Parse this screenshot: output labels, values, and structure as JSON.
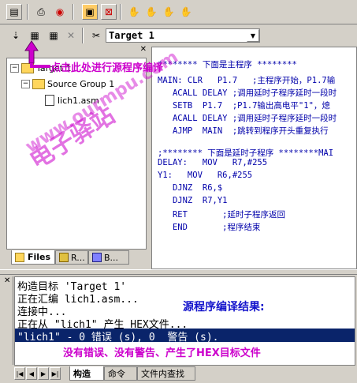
{
  "toolbar2": {
    "target_select": "Target 1"
  },
  "project_tree": {
    "root": "Target 1",
    "group": "Source Group 1",
    "file": "lich1.asm"
  },
  "project_tabs": {
    "files": "Files",
    "regs_label": "R...",
    "books_label": "B..."
  },
  "editor": {
    "lines": [
      "******** 下面是主程序 ********",
      "MAIN: CLR   P1.7   ;主程序开始，P1.7输",
      "   ACALL DELAY ;调用延时子程序延时一段时",
      "   SETB  P1.7  ;P1.7输出高电平\"1\"，熄",
      "   ACALL DELAY ;调用延时子程序延时一段时",
      "   AJMP  MAIN  ;跳转到程序开头重复执行",
      "",
      ";******** 下面是延时子程序 ********MAI",
      "DELAY:   MOV   R7,#255",
      "Y1:   MOV   R6,#255",
      "   DJNZ  R6,$",
      "   DJNZ  R7,Y1",
      "   RET       ;延时子程序返回",
      "   END       ;程序结束"
    ]
  },
  "annotations": {
    "compile_hint": "点击此处进行源程序编译",
    "watermark_1": "电子驿站",
    "watermark_2": "www.ourmpu.com",
    "result_title": "源程序编译结果:",
    "result_desc": "没有错误、没有警告、产生了HEX目标文件"
  },
  "output": {
    "lines": [
      "构造目标 'Target 1'",
      "正在汇编 lich1.asm...",
      "连接中...",
      "正在从 \"lich1\" 产生 HEX文件...",
      "\"lich1\" - 0 错误 (s), 0  警告 (s)."
    ],
    "tabs": [
      "构造",
      "命令",
      "文件内查找"
    ]
  },
  "colors": {
    "accent_magenta": "#cc00cc",
    "result_blue": "#1414cc",
    "selection": "#0a246a",
    "code_blue": "#0000aa"
  }
}
